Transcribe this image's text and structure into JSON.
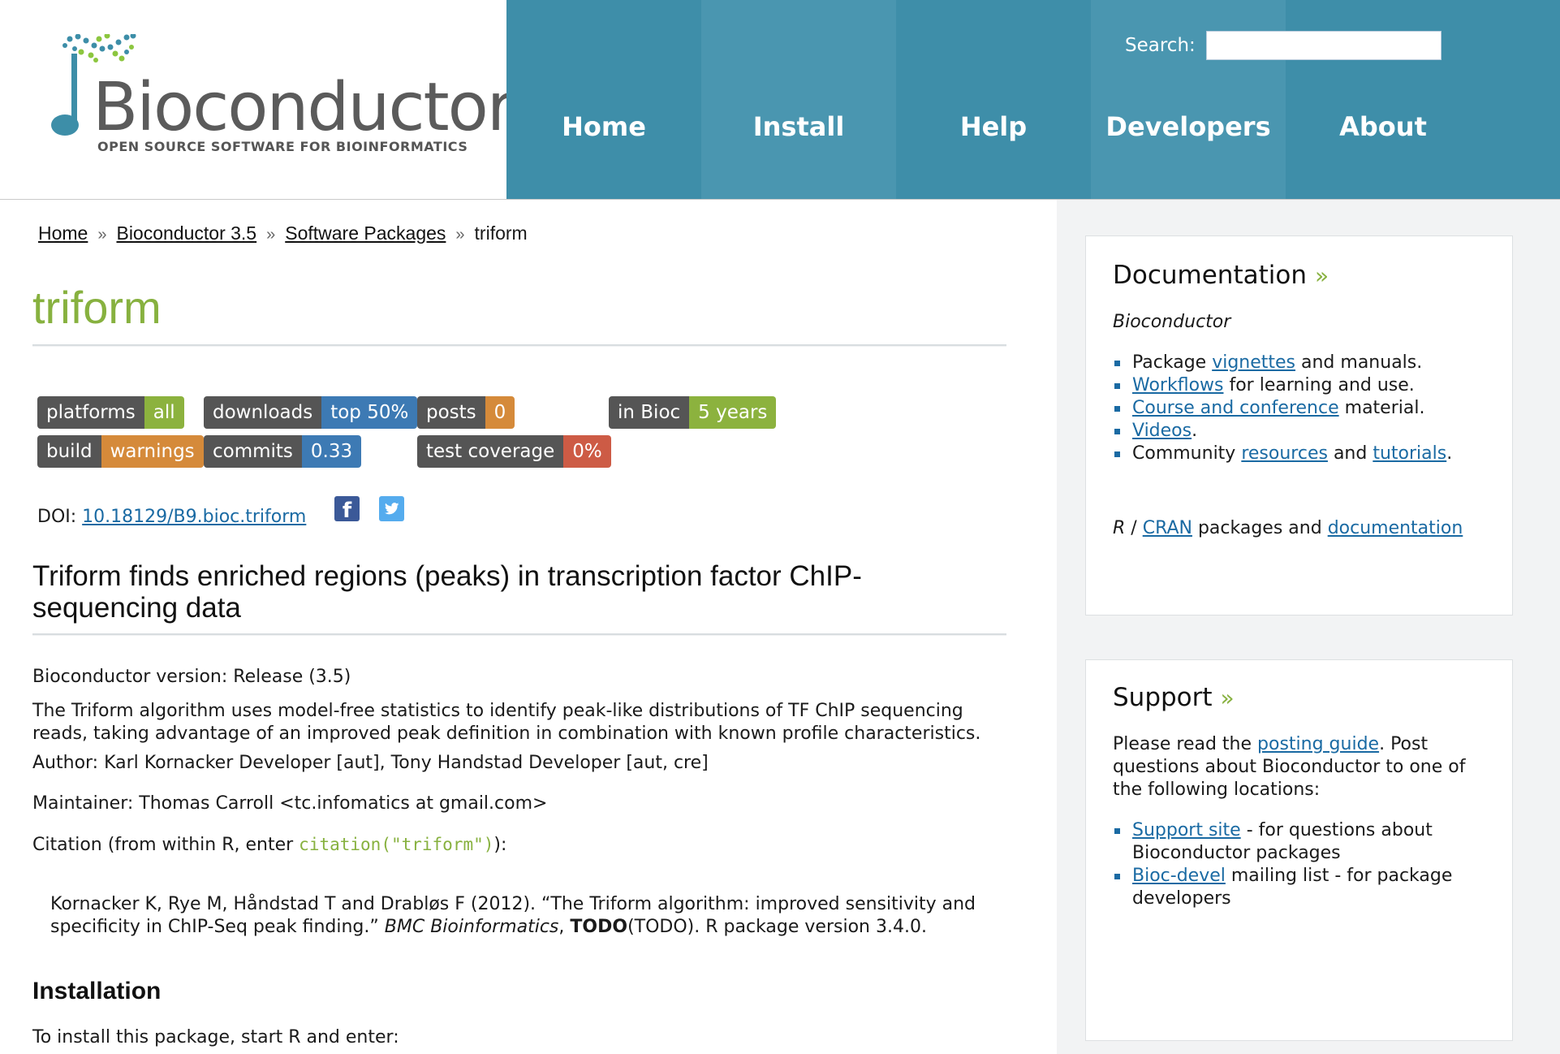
{
  "brand": {
    "name": "Bioconductor",
    "tagline": "OPEN SOURCE SOFTWARE FOR BIOINFORMATICS",
    "colors": {
      "nav_bg": "#3d8ea8",
      "title_green": "#87b13f",
      "link_blue": "#1a6aa3"
    }
  },
  "search": {
    "label": "Search:",
    "value": "",
    "placeholder": ""
  },
  "nav": {
    "items": [
      "Home",
      "Install",
      "Help",
      "Developers",
      "About"
    ]
  },
  "breadcrumb": {
    "separator": "»",
    "items": [
      "Home",
      "Bioconductor 3.5",
      "Software Packages",
      "triform"
    ]
  },
  "package": {
    "name": "triform",
    "badges": [
      {
        "key": "platforms",
        "value": "all",
        "color": "#8cb23e"
      },
      {
        "key": "downloads",
        "value": "top 50%",
        "color": "#3d7ab4"
      },
      {
        "key": "posts",
        "value": "0",
        "color": "#d58a3a"
      },
      {
        "key": "in Bioc",
        "value": "5 years",
        "color": "#8cb23e"
      },
      {
        "key": "build",
        "value": "warnings",
        "color": "#d58a3a"
      },
      {
        "key": "commits",
        "value": "0.33",
        "color": "#3d7ab4"
      },
      {
        "key": "test coverage",
        "value": "0%",
        "color": "#cd5b45"
      }
    ],
    "doi_label": "DOI:",
    "doi": "10.18129/B9.bioc.triform",
    "social_icons": [
      "facebook-icon",
      "twitter-icon"
    ],
    "title": "Triform finds enriched regions (peaks) in transcription factor ChIP-sequencing data",
    "version_line": "Bioconductor version: Release (3.5)",
    "description": "The Triform algorithm uses model-free statistics to identify peak-like distributions of TF ChIP sequencing reads, taking advantage of an improved peak definition in combination with known profile characteristics.",
    "author_line": "Author: Karl Kornacker Developer [aut], Tony Handstad Developer [aut, cre]",
    "maintainer_line": "Maintainer: Thomas Carroll <tc.infomatics at gmail.com>",
    "citation_prefix": "Citation (from within R, enter ",
    "citation_code": "citation(\"triform\")",
    "citation_suffix": "):",
    "citation": {
      "authors": "Kornacker K, Rye M, Håndstad T and Drabløs F (2012). “The Triform algorithm: improved sensitivity and specificity in ChIP-Seq peak finding.” ",
      "journal": "BMC Bioinformatics",
      "comma": ", ",
      "volume": "TODO",
      "rest": "(TODO). R package version 3.4.0."
    },
    "installation_heading": "Installation",
    "install_intro": "To install this package, start R and enter:"
  },
  "sidebar": {
    "documentation": {
      "title": "Documentation",
      "subtitle": "Bioconductor",
      "items": [
        {
          "pre": "Package ",
          "link": "vignettes",
          "post": " and manuals."
        },
        {
          "pre": "",
          "link": "Workflows",
          "post": " for learning and use."
        },
        {
          "pre": "",
          "link": "Course and conference",
          "post": " material."
        },
        {
          "pre": "",
          "link": "Videos",
          "post": "."
        },
        {
          "pre": "Community ",
          "link": "resources",
          "mid": " and ",
          "link2": "tutorials",
          "post": "."
        }
      ],
      "r_line": {
        "r": "R",
        "slash": " / ",
        "cran": "CRAN",
        "mid": " packages and ",
        "doc": "documentation"
      }
    },
    "support": {
      "title": "Support",
      "intro_pre": "Please read the ",
      "intro_link": "posting guide",
      "intro_post": ". Post questions about Bioconductor to one of the following locations:",
      "items": [
        {
          "link": "Support site",
          "post": " - for questions about Bioconductor packages"
        },
        {
          "link": "Bioc-devel",
          "post": " mailing list - for package developers"
        }
      ]
    }
  }
}
